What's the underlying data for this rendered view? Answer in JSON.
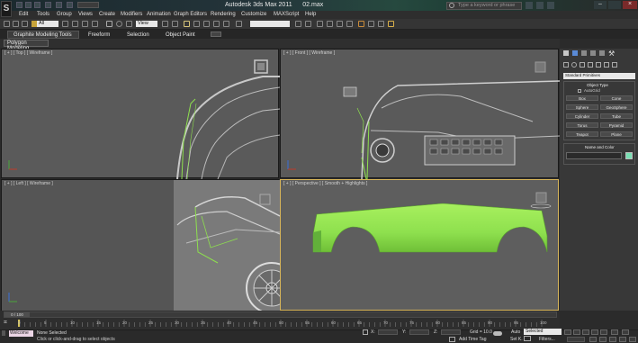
{
  "title_bar": {
    "app_title": "Autodesk 3ds Max  2011",
    "file_name": "02.max",
    "search_placeholder": "Type a keyword or phrase"
  },
  "menu": [
    "Edit",
    "Tools",
    "Group",
    "Views",
    "Create",
    "Modifiers",
    "Animation",
    "Graph Editors",
    "Rendering",
    "Customize",
    "MAXScript",
    "Help"
  ],
  "toolbar": {
    "selection_filter": "All",
    "view_dropdown": "View"
  },
  "ribbon": {
    "tabs": [
      "Graphite Modeling Tools",
      "Freeform",
      "Selection",
      "Object Paint"
    ],
    "active_tab": "Graphite Modeling Tools",
    "panel_label": "Polygon Modeling"
  },
  "viewports": {
    "top": "[ + ] [ Top ] [ Wireframe ]",
    "front": "[ + ] [ Front ] [ Wireframe ]",
    "left": "[ + ] [ Left ] [ Wireframe ]",
    "perspective": "[ + ] [ Perspective ] [ Smooth + Highlights ]"
  },
  "command_panel": {
    "category_dropdown": "Standard Primitives",
    "object_type_header": "Object Type",
    "autogrid_label": "AutoGrid",
    "primitives": [
      "Box",
      "Cone",
      "Sphere",
      "GeoSphere",
      "Cylinder",
      "Tube",
      "Torus",
      "Pyramid",
      "Teapot",
      "Plane"
    ],
    "name_color_header": "Name and Color",
    "object_color": "#7ae0b4"
  },
  "timeline": {
    "frame_counter": "0 / 100",
    "ticks": [
      "0",
      "5",
      "10",
      "15",
      "20",
      "25",
      "30",
      "35",
      "40",
      "45",
      "50",
      "55",
      "60",
      "65",
      "70",
      "75",
      "80",
      "85",
      "90",
      "95",
      "100"
    ]
  },
  "status": {
    "listener_text": "Welcome to",
    "selection_status": "None Selected",
    "prompt": "Click or click-and-drag to select objects",
    "grid_label": "Grid = 10.0",
    "add_time_tag": "Add Time Tag",
    "auto_label": "Auto",
    "set_key_label": "Set K.",
    "key_filter_value": "Selected",
    "filters_label": "Filters...",
    "x_label": "X:",
    "y_label": "Y:",
    "z_label": "Z:"
  },
  "colors": {
    "selection_green": "#8ee04e",
    "viewport_active_border": "#d7b55a"
  }
}
